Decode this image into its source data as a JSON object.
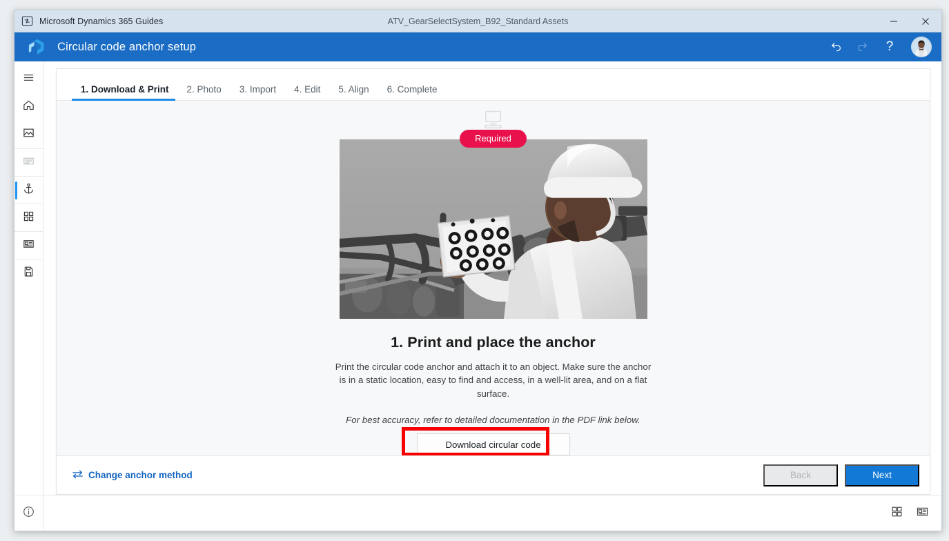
{
  "titlebar": {
    "app_name": "Microsoft Dynamics 365 Guides",
    "document_title": "ATV_GearSelectSystem_B92_Standard Assets",
    "app_icon": "guides-app-icon",
    "minimize_label": "–",
    "close_label": "✕"
  },
  "header": {
    "title": "Circular code anchor setup",
    "logo": "dynamics-guides-logo",
    "undo_icon": "undo-icon",
    "redo_icon": "redo-icon",
    "help_label": "?",
    "avatar": "user-avatar",
    "accent_color": "#1a6cc4"
  },
  "sidebar": {
    "items": [
      {
        "name": "menu-toggle",
        "icon": "hamburger-icon",
        "state": "normal"
      },
      {
        "name": "home",
        "icon": "home-icon",
        "state": "normal"
      },
      {
        "name": "media",
        "icon": "image-icon",
        "state": "normal"
      },
      {
        "name": "steps",
        "icon": "list-text-icon",
        "state": "dimmed"
      },
      {
        "name": "anchor",
        "icon": "anchor-icon",
        "state": "active"
      },
      {
        "name": "apps",
        "icon": "grid-icon",
        "state": "normal"
      },
      {
        "name": "layout",
        "icon": "card-layout-icon",
        "state": "normal"
      },
      {
        "name": "save",
        "icon": "save-icon",
        "state": "normal"
      }
    ],
    "info_icon": "info-circle-icon"
  },
  "tabs": [
    {
      "label": "1. Download & Print",
      "active": true
    },
    {
      "label": "2. Photo",
      "active": false
    },
    {
      "label": "3. Import",
      "active": false
    },
    {
      "label": "4. Edit",
      "active": false
    },
    {
      "label": "5. Align",
      "active": false
    },
    {
      "label": "6. Complete",
      "active": false
    }
  ],
  "main": {
    "device_icon": "desktop-monitor-icon",
    "badge": "Required",
    "badge_color": "#e8114b",
    "hero_image_alt": "technician-placing-circular-code-anchor",
    "step_title": "1. Print and place the anchor",
    "step_description": "Print the circular code anchor and attach it to an object. Make sure the anchor is in a static location, easy to find and access, in a well-lit area, and on a flat surface.",
    "step_note": "For best accuracy, refer to detailed documentation in the PDF link below.",
    "download_button": "Download circular code",
    "highlight_color": "#f80000"
  },
  "footer": {
    "change_method_label": "Change anchor method",
    "change_method_icon": "swap-arrows-icon",
    "back_label": "Back",
    "next_label": "Next",
    "back_disabled": true
  },
  "statusbar": {
    "grid_view_icon": "grid-view-icon",
    "card_view_icon": "card-view-icon"
  }
}
